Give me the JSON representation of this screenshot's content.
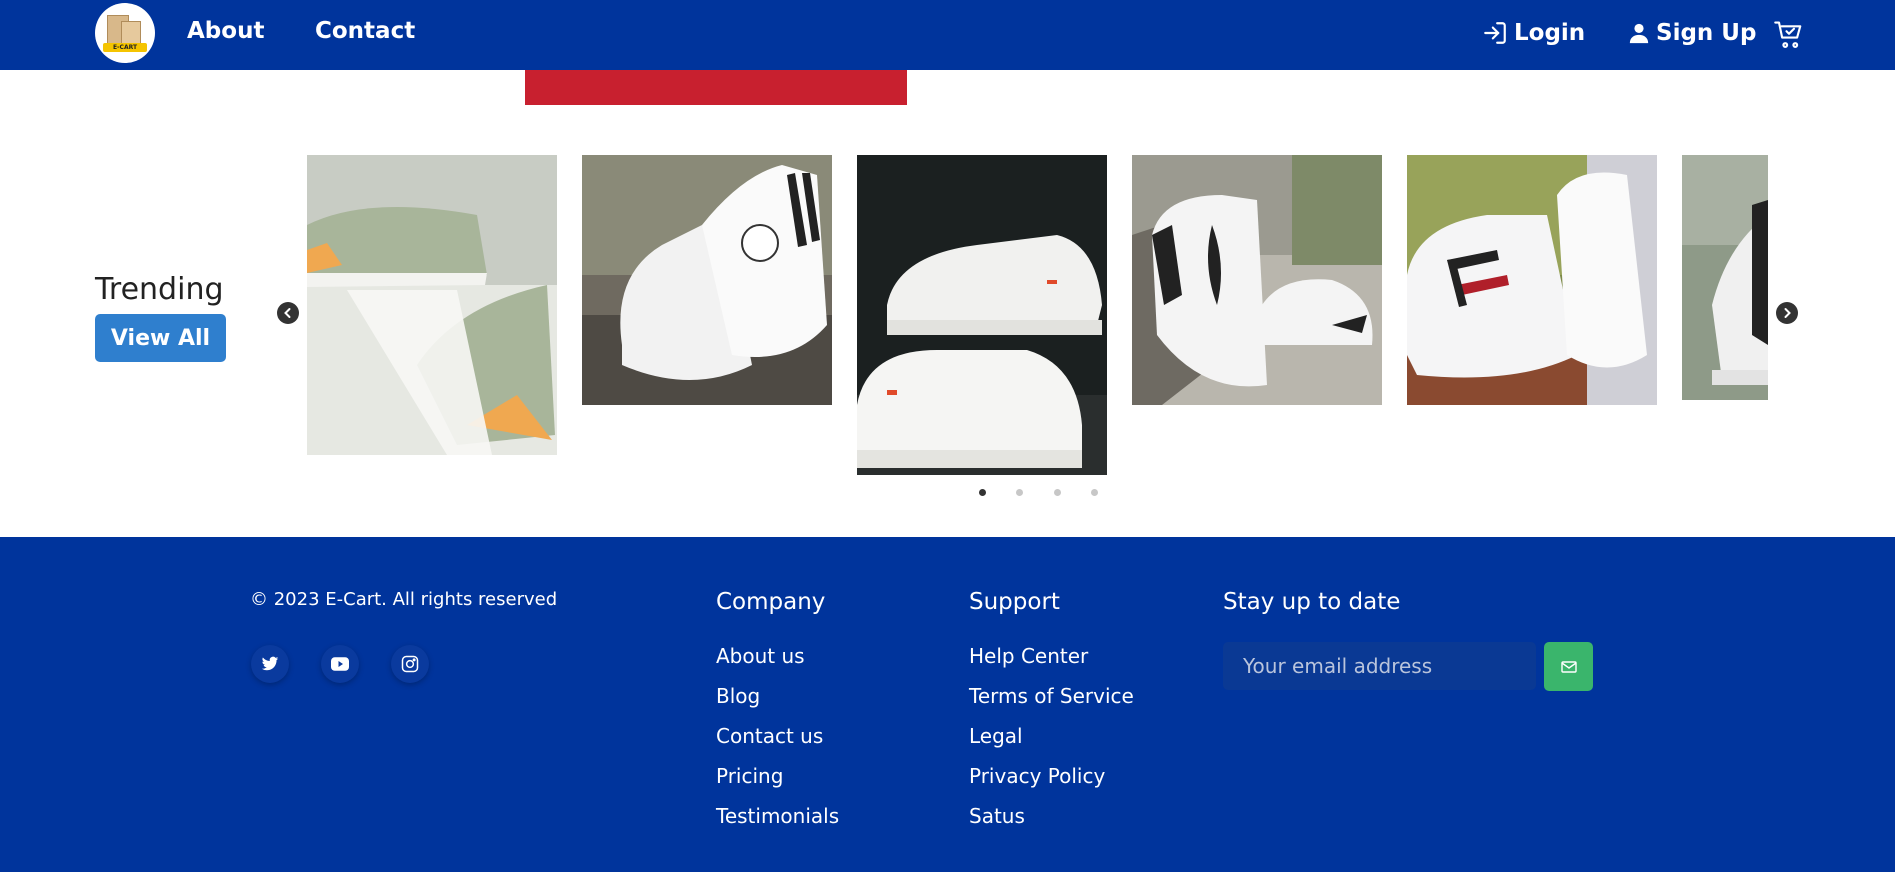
{
  "navbar": {
    "logo_text": "E-CART",
    "links": [
      {
        "label": "About"
      },
      {
        "label": "Contact"
      }
    ],
    "login_label": "Login",
    "signup_label": "Sign Up",
    "cart_icon": "cart-icon",
    "bg_color": "#00349c"
  },
  "trending": {
    "title": "Trending",
    "view_all_label": "View All",
    "prev_icon": "chevron-left-icon",
    "next_icon": "chevron-right-icon",
    "products": [
      {
        "name": "green sneaker"
      },
      {
        "name": "white high-top sneaker"
      },
      {
        "name": "white low sneaker"
      },
      {
        "name": "white feather sneaker"
      },
      {
        "name": "white striped sneaker"
      },
      {
        "name": "black white sneaker"
      }
    ],
    "dots": 4,
    "active_dot": 0
  },
  "footer": {
    "copyright": "© 2023 E-Cart. All rights reserved",
    "social_icons": [
      "twitter-icon",
      "youtube-icon",
      "instagram-icon"
    ],
    "company": {
      "title": "Company",
      "links": [
        "About us",
        "Blog",
        "Contact us",
        "Pricing",
        "Testimonials"
      ]
    },
    "support": {
      "title": "Support",
      "links": [
        "Help Center",
        "Terms of Service",
        "Legal",
        "Privacy Policy",
        "Satus"
      ]
    },
    "newsletter": {
      "title": "Stay up to date",
      "placeholder": "Your email address",
      "send_icon": "send-icon"
    },
    "bg_color": "#00349c",
    "button_color": "#3ab56c"
  }
}
